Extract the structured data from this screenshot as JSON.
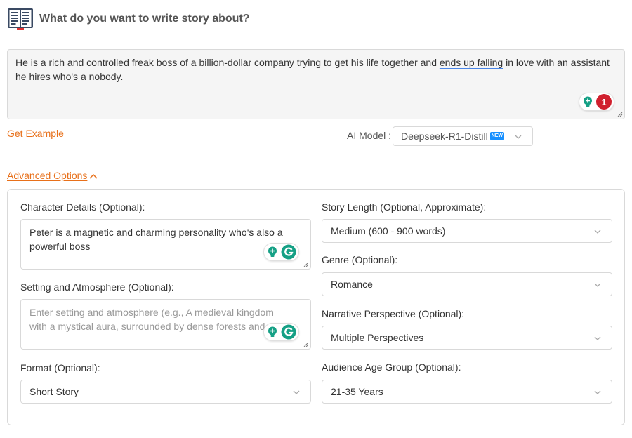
{
  "header": {
    "icon": "book-icon",
    "title": "What do you want to write story about?"
  },
  "main_prompt": {
    "text_before": "He is a rich and controlled freak boss of a billion-dollar company trying to get his life together and ",
    "text_underlined": "ends up falling",
    "text_after": " in love with an assistant he hires who's a nobody.",
    "grammarly_count": "1"
  },
  "get_example": "Get Example",
  "ai_model": {
    "label": "AI Model :",
    "value": "Deepseek-R1-Distill",
    "badge": "NEW"
  },
  "advanced": {
    "toggle_label": "Advanced Options",
    "character": {
      "label": "Character Details (Optional):",
      "value": "Peter is a magnetic and charming personality who's also a powerful boss"
    },
    "setting": {
      "label": "Setting and Atmosphere (Optional):",
      "placeholder": "Enter setting and atmosphere (e.g., A medieval kingdom with a mystical aura, surrounded by dense forests and ancient ruins)"
    },
    "format": {
      "label": "Format (Optional):",
      "value": "Short Story"
    },
    "story_length": {
      "label": "Story Length (Optional, Approximate):",
      "value": "Medium (600 - 900 words)"
    },
    "genre": {
      "label": "Genre (Optional):",
      "value": "Romance"
    },
    "perspective": {
      "label": "Narrative Perspective (Optional):",
      "value": "Multiple Perspectives"
    },
    "audience": {
      "label": "Audience Age Group (Optional):",
      "value": "21-35 Years"
    }
  },
  "colors": {
    "accent": "#e8701a",
    "grammarly_green": "#15a085",
    "badge_red": "#d0202e",
    "new_badge": "#1890ff"
  }
}
